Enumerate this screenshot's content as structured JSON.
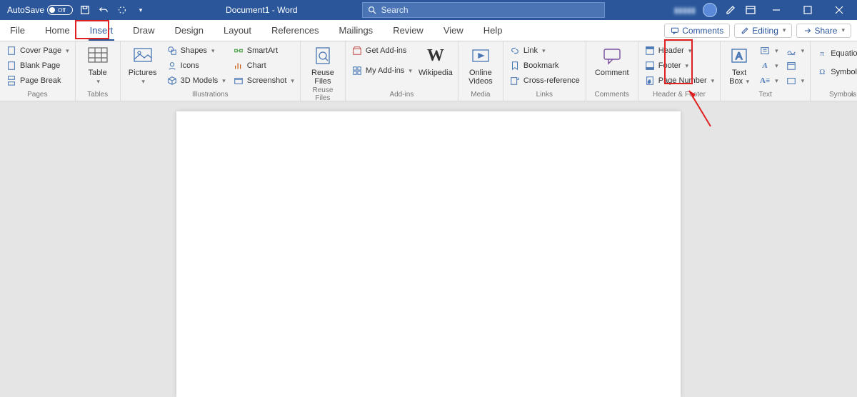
{
  "titlebar": {
    "autosave": "AutoSave",
    "autosave_state": "Off",
    "doc_title": "Document1 - Word",
    "search_placeholder": "Search"
  },
  "tabs": {
    "file": "File",
    "home": "Home",
    "insert": "Insert",
    "draw": "Draw",
    "design": "Design",
    "layout": "Layout",
    "references": "References",
    "mailings": "Mailings",
    "review": "Review",
    "view": "View",
    "help": "Help"
  },
  "right_tools": {
    "comments": "Comments",
    "editing": "Editing",
    "share": "Share"
  },
  "ribbon": {
    "pages": {
      "cover_page": "Cover Page",
      "blank_page": "Blank Page",
      "page_break": "Page Break",
      "group": "Pages"
    },
    "tables": {
      "table": "Table",
      "group": "Tables"
    },
    "illustrations": {
      "pictures": "Pictures",
      "shapes": "Shapes",
      "icons": "Icons",
      "models": "3D Models",
      "smartart": "SmartArt",
      "chart": "Chart",
      "screenshot": "Screenshot",
      "group": "Illustrations"
    },
    "reuse": {
      "label": "Reuse Files",
      "group": "Reuse Files"
    },
    "addins": {
      "get": "Get Add-ins",
      "my": "My Add-ins",
      "wikipedia": "Wikipedia",
      "group": "Add-ins"
    },
    "media": {
      "label": "Online Videos",
      "group": "Media"
    },
    "links": {
      "link": "Link",
      "bookmark": "Bookmark",
      "cross": "Cross-reference",
      "group": "Links"
    },
    "comments": {
      "label": "Comment",
      "group": "Comments"
    },
    "hf": {
      "header": "Header",
      "footer": "Footer",
      "pagenum": "Page Number",
      "group": "Header & Footer"
    },
    "text": {
      "textbox": "Text Box",
      "group": "Text"
    },
    "symbols": {
      "equation": "Equation",
      "symbol": "Symbol",
      "group": "Symbols"
    }
  }
}
